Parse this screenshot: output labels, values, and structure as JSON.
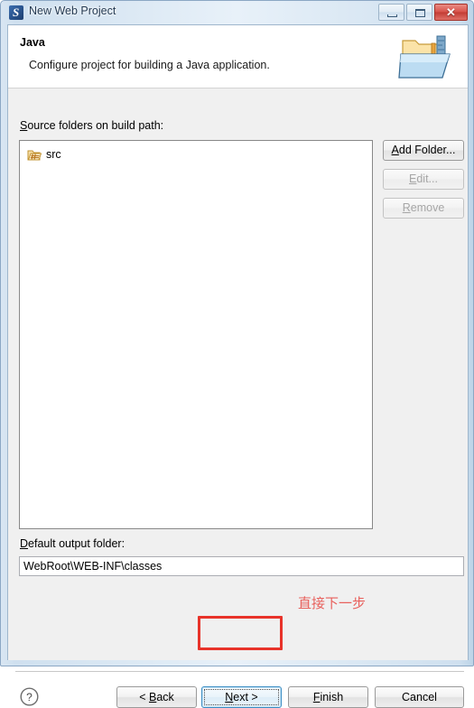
{
  "window": {
    "title": "New Web Project",
    "app_icon": "myeclipse-icon",
    "controls": {
      "minimize": "minimize-icon",
      "maximize": "maximize-icon",
      "close": "close-icon",
      "close_glyph": "✕"
    }
  },
  "header": {
    "title": "Java",
    "description": "Configure project for building a Java application.",
    "icon": "java-build-folder-icon"
  },
  "source_section": {
    "label_mnemonic": "S",
    "label_rest": "ource folders on build path:",
    "items": [
      {
        "name": "src",
        "icon": "package-folder-icon"
      }
    ],
    "buttons": [
      {
        "mnemonic": "A",
        "rest": "dd Folder...",
        "enabled": true
      },
      {
        "mnemonic": "E",
        "rest": "dit...",
        "enabled": false
      },
      {
        "mnemonic": "R",
        "rest": "emove",
        "enabled": false
      }
    ]
  },
  "output_section": {
    "label_mnemonic": "D",
    "label_rest": "efault output folder:",
    "value": "WebRoot\\WEB-INF\\classes",
    "placeholder": ""
  },
  "footer": {
    "help": "help-icon",
    "buttons": {
      "back": {
        "pre": "< ",
        "mnemonic": "B",
        "rest": "ack"
      },
      "next": {
        "pre": "",
        "mnemonic": "N",
        "rest": "ext >"
      },
      "finish": {
        "pre": "",
        "mnemonic": "F",
        "rest": "inish"
      },
      "cancel": {
        "pre": "",
        "mnemonic": "",
        "rest": "Cancel"
      }
    }
  },
  "annotation": {
    "text": "直接下一步",
    "color": "#e8332a"
  }
}
